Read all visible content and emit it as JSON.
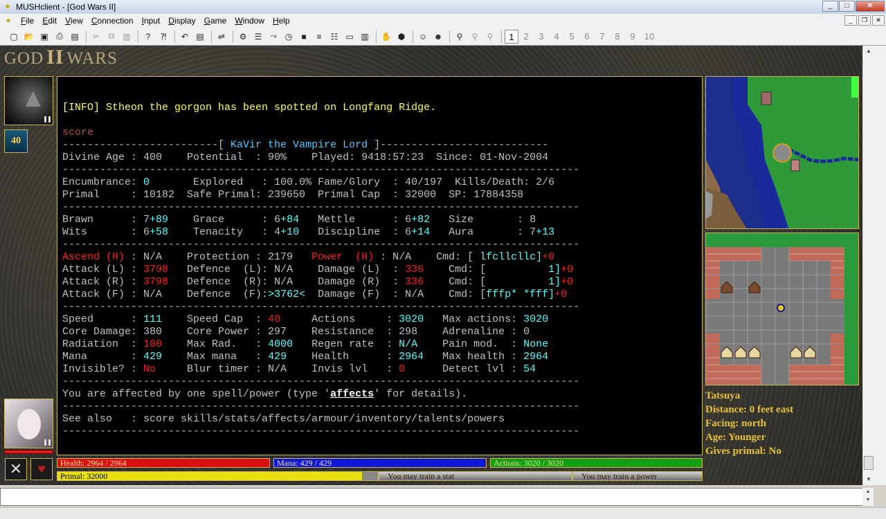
{
  "window": {
    "title": "MUSHclient - [God Wars II]"
  },
  "menu": [
    "File",
    "Edit",
    "View",
    "Connection",
    "Input",
    "Display",
    "Game",
    "Window",
    "Help"
  ],
  "toolbar": {
    "worlds": [
      "1",
      "2",
      "3",
      "4",
      "5",
      "6",
      "7",
      "8",
      "9",
      "10"
    ],
    "selected_world": "1"
  },
  "logo": {
    "left": "GOD",
    "mid": "II",
    "right": "WARS"
  },
  "level_badge": "40",
  "output": {
    "info_line": "[INFO] Stheon the gorgon has been spotted on Longfang Ridge.",
    "echo": "score",
    "header_left": "-------------------------[ ",
    "header_name": "KaVir the Vampire Lord",
    "header_right": " ]---------------------------",
    "dash": "-----------------------------------------------------------------------------------",
    "r1": "Divine Age : 400    Potential  : 90%    Played: 9418:57:23  Since: 01-Nov-2004",
    "enc_label": "Encumbrance: ",
    "enc_val": "0",
    "enc_rest": "       Explored   : 100.0% Fame/Glory  : 40/197  Kills/Death: 2/6",
    "r3": "Primal     : 10182  Safe Primal: 239650  Primal Cap  : 32000  SP: 17884358",
    "brawn": {
      "pre": "Brawn      : 7",
      "bonus": "+89",
      "mid": "    Grace      : 6",
      "bonus2": "+84",
      "mid2": "   Mettle      : 6",
      "bonus3": "+82",
      "post": "   Size       : 8"
    },
    "wits": {
      "pre": "Wits       : 6",
      "bonus": "+58",
      "mid": "    Tenacity   : 4",
      "bonus2": "+10",
      "mid2": "   Discipline  : 6",
      "bonus3": "+14",
      "mid3": "   Aura       : 7",
      "bonus4": "+13"
    },
    "ascend": {
      "label": "Ascend (H)",
      "rest1": " : N/A    Protection : 2179   ",
      "power": "Power  (H)",
      "rest2": " : N/A    Cmd: [ ",
      "cmd": "lfcllcllc",
      "end": "]",
      "plus": "+0"
    },
    "atkl": {
      "pre": "Attack (L) : ",
      "val": "3798",
      "mid": "   Defence  (L): N/A    Damage (L)  : ",
      "dmg": "336",
      "cmd": "    Cmd: [          ",
      "end": "1]",
      "plus": "+0"
    },
    "atkr": {
      "pre": "Attack (R) : ",
      "val": "3798",
      "mid": "   Defence  (R): N/A    Damage (R)  : ",
      "dmg": "336",
      "cmd": "    Cmd: [          ",
      "end": "1]",
      "plus": "+0"
    },
    "atkf": {
      "pre": "Attack (F) : N/A    Defence  (F):",
      "def": ">3762<",
      "mid": "  Damage (F)  : N/A    Cmd: [",
      "cmd": "fffp* *fff]",
      "plus": "+0"
    },
    "speed": {
      "pre": "Speed      : ",
      "val": "111",
      "mid": "    Speed Cap  : ",
      "cap": "40",
      "mid2": "     Actions     : ",
      "act": "3020",
      "mid3": "   Max actions: ",
      "max": "3020"
    },
    "core": "Core Damage: 380    Core Power : 297    Resistance  : 298    Adrenaline : 0",
    "rad": {
      "pre": "Radiation  : ",
      "val": "100",
      "mid": "    Max Rad.   : ",
      "max": "4000",
      "mid2": "   Regen rate  : ",
      "regen": "N/A",
      "mid3": "    Pain mod.  : ",
      "pain": "None"
    },
    "mana": {
      "pre": "Mana       : ",
      "val": "429",
      "mid": "    Max mana   : ",
      "max": "429",
      "mid2": "    Health      : ",
      "hp": "2964",
      "mid3": "   Max health : ",
      "maxhp": "2964"
    },
    "invis": {
      "pre": "Invisible? : ",
      "val": "No",
      "mid": "     Blur timer : N/A    Invis lvl   : ",
      "lvl": "0",
      "mid2": "      Detect lvl : ",
      "det": "54"
    },
    "affect": {
      "pre": "You are affected by one spell/power (type '",
      "cmd": "affects",
      "post": "' for details)."
    },
    "seealso": "See also   : score skills/stats/affects/armour/inventory/talents/powers"
  },
  "bars": {
    "health": {
      "label": "Health: 2964 / 2964",
      "fraction": 1.0,
      "color": "#d81010"
    },
    "mana": {
      "label": "Mana: 429 / 429",
      "fraction": 1.0,
      "color": "#1018d8"
    },
    "actions": {
      "label": "Actions: 3020 / 3020",
      "fraction": 1.0,
      "color": "#10a010"
    },
    "primal": {
      "label": "Primal: 32000",
      "fraction": 0.95,
      "color": "#e8e010"
    },
    "train_stat": "You may train a stat",
    "train_power": "You may train a power"
  },
  "info_panel": {
    "name": "Tatsuya",
    "distance": "Distance: 0 feet east",
    "facing": "Facing: north",
    "age": "Age: Younger",
    "primal": "Gives primal: No"
  }
}
